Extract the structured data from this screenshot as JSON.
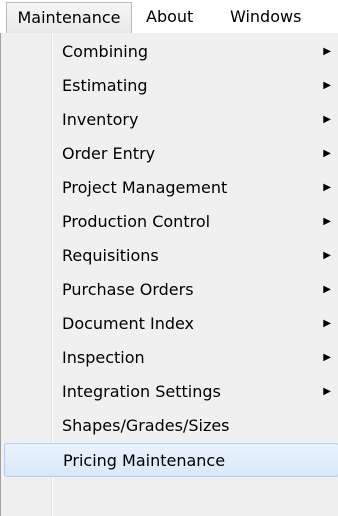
{
  "menubar": {
    "items": [
      {
        "label": "Maintenance"
      },
      {
        "label": "About"
      },
      {
        "label": "Windows"
      }
    ]
  },
  "menu": {
    "items": [
      {
        "label": "Combining",
        "submenu": true
      },
      {
        "label": "Estimating",
        "submenu": true
      },
      {
        "label": "Inventory",
        "submenu": true
      },
      {
        "label": "Order Entry",
        "submenu": true
      },
      {
        "label": "Project Management",
        "submenu": true
      },
      {
        "label": "Production Control",
        "submenu": true
      },
      {
        "label": "Requisitions",
        "submenu": true
      },
      {
        "label": "Purchase Orders",
        "submenu": true
      },
      {
        "label": "Document Index",
        "submenu": true
      },
      {
        "label": "Inspection",
        "submenu": true
      },
      {
        "label": "Integration Settings",
        "submenu": true
      },
      {
        "label": "Shapes/Grades/Sizes",
        "submenu": false
      },
      {
        "label": "Pricing Maintenance",
        "submenu": false,
        "selected": true
      }
    ],
    "submenu_arrow_glyph": "▶"
  }
}
